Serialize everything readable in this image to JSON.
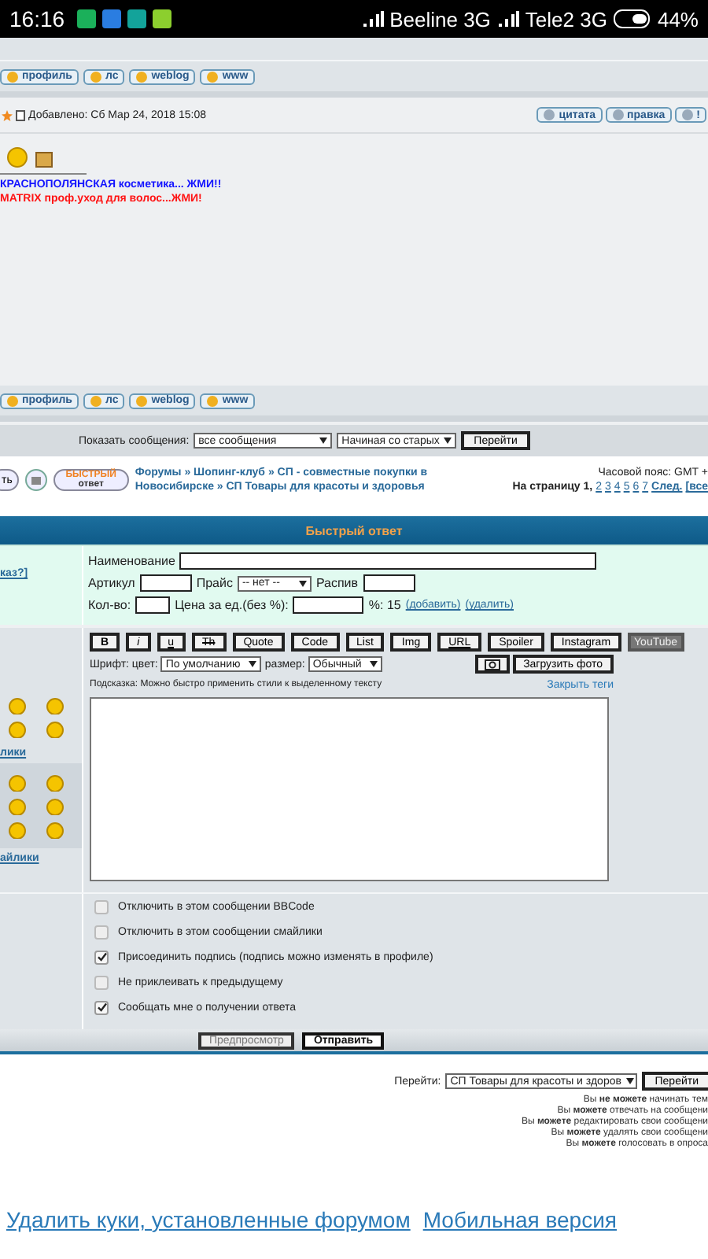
{
  "status_bar": {
    "time": "16:16",
    "carrier_1": "Beeline 3G",
    "carrier_2": "Tele2 3G",
    "battery": "44%"
  },
  "profile_buttons_top": [
    "профиль",
    "лс",
    "weblog",
    "www"
  ],
  "post": {
    "added": "Добавлено: Сб Мар 24, 2018 15:08",
    "actions": [
      "цитата",
      "правка",
      "!"
    ],
    "signature": [
      {
        "text": "КРАСНОПОЛЯНСКАЯ косметика... ЖМИ!!",
        "color": "#1414ff"
      },
      {
        "text": "MATRIX проф.уход для волос...ЖМИ!",
        "color": "#ff1414"
      }
    ]
  },
  "profile_buttons_bottom": [
    "профиль",
    "лс",
    "weblog",
    "www"
  ],
  "display": {
    "label": "Показать сообщения:",
    "filter": "все сообщения",
    "order": "Начиная со старых",
    "go": "Перейти"
  },
  "nav": {
    "reply_cut": "ть",
    "quick_reply_top": "БЫСТРЫЙ",
    "quick_reply_bottom": "ответ",
    "breadcrumbs": "Форумы » Шопинг-клуб » СП - совместные покупки в Новосибирске » СП Товары для красоты и здоровья",
    "timezone": "Часовой пояс: GMT +",
    "pages_label": "На страницу 1,",
    "pages": [
      "2",
      "3",
      "4",
      "5",
      "6",
      "7"
    ],
    "next": "След.",
    "all": "[все"
  },
  "quick_reply": {
    "title": "Быстрый ответ",
    "side_link": "каз?]",
    "name_label": "Наименование",
    "article_label": "Артикул",
    "price_label": "Прайс",
    "price_value": "-- нет --",
    "split_label": "Распив",
    "qty_label": "Кол-во:",
    "unit_price_label": "Цена за ед.(без %):",
    "percent": "%: 15",
    "add": "(добавить)",
    "remove": "(удалить)"
  },
  "toolbar": [
    {
      "label": "B",
      "kind": "bold"
    },
    {
      "label": "i",
      "kind": "italic"
    },
    {
      "label": "u",
      "kind": "underline"
    },
    {
      "label": "Th",
      "kind": "strike"
    },
    {
      "label": "Quote",
      "kind": "plain"
    },
    {
      "label": "Code",
      "kind": "plain"
    },
    {
      "label": "List",
      "kind": "plain"
    },
    {
      "label": "Img",
      "kind": "plain"
    },
    {
      "label": "URL",
      "kind": "underline"
    },
    {
      "label": "Spoiler",
      "kind": "plain"
    },
    {
      "label": "Instagram",
      "kind": "plain"
    },
    {
      "label": "YouTube",
      "kind": "logo"
    }
  ],
  "font": {
    "label": "Шрифт: цвет:",
    "color_value": "По умолчанию",
    "size_label": "размер:",
    "size_value": "Обычный",
    "upload": "Загрузить фото"
  },
  "hint": "Подсказка: Можно быстро применить стили к выделенному тексту",
  "close_tags": "Закрыть теги",
  "smileys_link": "лики",
  "all_smileys_link": "айлики",
  "checkboxes": [
    {
      "label": "Отключить в этом сообщении BBCode",
      "checked": false
    },
    {
      "label": "Отключить в этом сообщении смайлики",
      "checked": false
    },
    {
      "label": "Присоединить подпись (подпись можно изменять в профиле)",
      "checked": true
    },
    {
      "label": "Не приклеивать к предыдущему",
      "checked": false
    },
    {
      "label": "Сообщать мне о получении ответа",
      "checked": true
    }
  ],
  "submit_buttons": [
    "Предпросмотр",
    "Отправить"
  ],
  "jump": {
    "label": "Перейти:",
    "value": "СП Товары для красоты и здоров",
    "go": "Перейти"
  },
  "permissions": [
    "Вы **не можете** начинать тем",
    "Вы **можете** отвечать на сообщени",
    "Вы **можете** редактировать свои сообщени",
    "Вы **можете** удалять свои сообщени",
    "Вы **можете** голосовать в опроса"
  ],
  "footer_links": [
    "Удалить куки, установленные форумом",
    "Мобильная версия"
  ]
}
